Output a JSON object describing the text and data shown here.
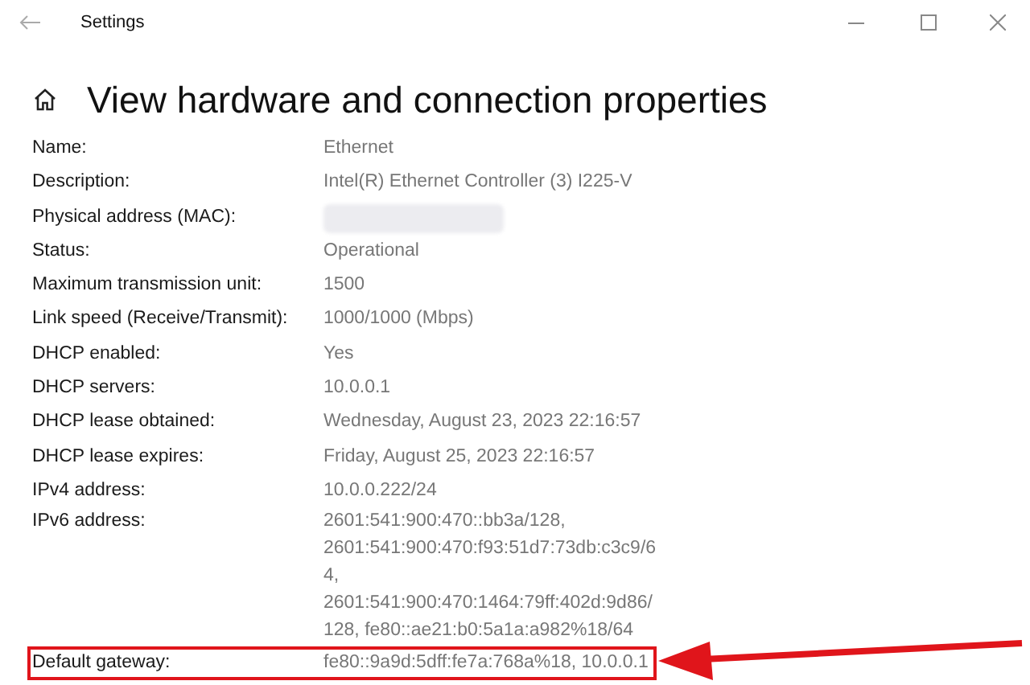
{
  "window": {
    "title": "Settings"
  },
  "page": {
    "heading": "View hardware and connection properties"
  },
  "properties": [
    {
      "kind": "plain",
      "label": "Name:",
      "lines": [
        "Ethernet"
      ]
    },
    {
      "kind": "plain",
      "label": "Description:",
      "lines": [
        "Intel(R) Ethernet Controller (3) I225-V"
      ]
    },
    {
      "kind": "redacted",
      "label": "Physical address (MAC):"
    },
    {
      "kind": "plain",
      "label": "Status:",
      "lines": [
        "Operational"
      ]
    },
    {
      "kind": "plain",
      "label": "Maximum transmission unit:",
      "lines": [
        "1500"
      ]
    },
    {
      "kind": "plain",
      "label": "Link speed (Receive/Transmit):",
      "lines": [
        "1000/1000 (Mbps)"
      ]
    },
    {
      "kind": "plain",
      "label": "DHCP enabled:",
      "lines": [
        "Yes"
      ]
    },
    {
      "kind": "plain",
      "label": "DHCP servers:",
      "lines": [
        "10.0.0.1"
      ]
    },
    {
      "kind": "plain",
      "label": "DHCP lease obtained:",
      "lines": [
        "Wednesday, August 23, 2023 22:16:57"
      ]
    },
    {
      "kind": "plain",
      "label": "DHCP lease expires:",
      "lines": [
        "Friday, August 25, 2023 22:16:57"
      ]
    },
    {
      "kind": "plain",
      "label": "IPv4 address:",
      "lines": [
        "10.0.0.222/24"
      ]
    },
    {
      "kind": "plain",
      "label": "IPv6 address:",
      "lines": [
        "2601:541:900:470::bb3a/128,",
        "2601:541:900:470:f93:51d7:73db:c3c9/6",
        "4,",
        "2601:541:900:470:1464:79ff:402d:9d86/",
        "128, fe80::ae21:b0:5a1a:a982%18/64"
      ]
    },
    {
      "kind": "highlighted",
      "label": "Default gateway:",
      "lines": [
        "fe80::9a9d:5dff:fe7a:768a%18, 10.0.0.1"
      ]
    }
  ]
}
